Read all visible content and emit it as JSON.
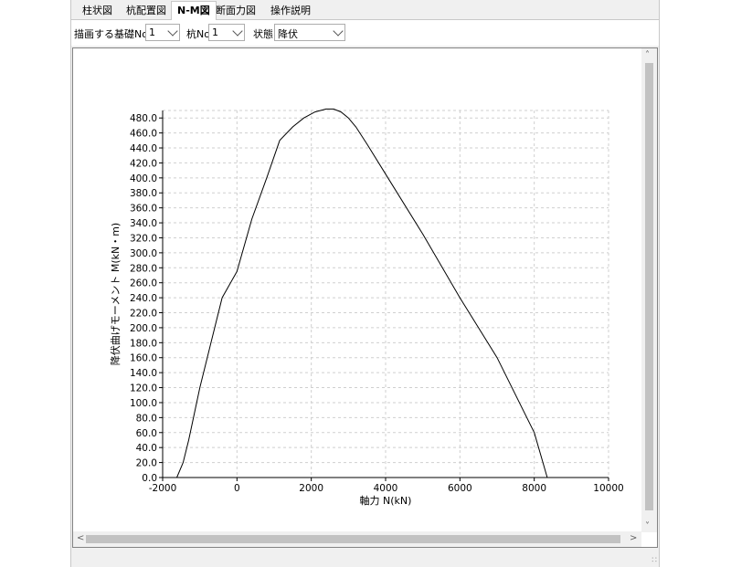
{
  "tabs": [
    {
      "label": "柱状図"
    },
    {
      "label": "杭配置図"
    },
    {
      "label": "N-M図"
    },
    {
      "label": "断面力図"
    },
    {
      "label": "操作説明"
    }
  ],
  "toolbar": {
    "foundation_label": "描画する基礎No",
    "foundation_value": "1",
    "pile_label": "杭No",
    "pile_value": "1",
    "state_label": "状態",
    "state_value": "降伏"
  },
  "icons": {
    "scroll_up": "scroll-up-arrow-icon",
    "scroll_down": "scroll-down-arrow-icon",
    "scroll_left": "scroll-left-arrow-icon",
    "scroll_right": "scroll-right-arrow-icon",
    "dropdown": "chevron-down-icon",
    "resize_grip": "resize-grip-icon"
  },
  "chart_data": {
    "type": "line",
    "title": "",
    "xlabel": "軸力 N(kN)",
    "ylabel": "降伏曲げモーメント M(kN・m)",
    "xlim": [
      -2000,
      10000
    ],
    "ylim": [
      0,
      490
    ],
    "x_ticks": [
      -2000,
      0,
      2000,
      4000,
      6000,
      8000,
      10000
    ],
    "x_tick_labels": [
      "-2000",
      "0",
      "2000",
      "4000",
      "6000",
      "8000",
      "10000"
    ],
    "y_ticks": [
      0,
      20,
      40,
      60,
      80,
      100,
      120,
      140,
      160,
      180,
      200,
      220,
      240,
      260,
      280,
      300,
      320,
      340,
      360,
      380,
      400,
      420,
      440,
      460,
      480
    ],
    "y_tick_labels": [
      "0.0",
      "20.0",
      "40.0",
      "60.0",
      "80.0",
      "100.0",
      "120.0",
      "140.0",
      "160.0",
      "180.0",
      "200.0",
      "220.0",
      "240.0",
      "260.0",
      "280.0",
      "300.0",
      "320.0",
      "340.0",
      "360.0",
      "380.0",
      "400.0",
      "420.0",
      "440.0",
      "460.0",
      "480.0"
    ],
    "grid": true,
    "line_color": "#000000",
    "series": [
      {
        "x": [
          -1620,
          -1450,
          -1300,
          -1000,
          -700,
          -400,
          0,
          400,
          800,
          1150,
          1500,
          1800,
          2100,
          2400,
          2600,
          2800,
          3000,
          3200,
          3500,
          4000,
          5000,
          6000,
          7000,
          8000,
          8350
        ],
        "y": [
          0,
          20,
          50,
          120,
          180,
          240,
          275,
          345,
          400,
          450,
          468,
          480,
          488,
          492,
          492,
          488,
          480,
          468,
          445,
          405,
          325,
          240,
          160,
          60,
          0
        ]
      }
    ]
  }
}
